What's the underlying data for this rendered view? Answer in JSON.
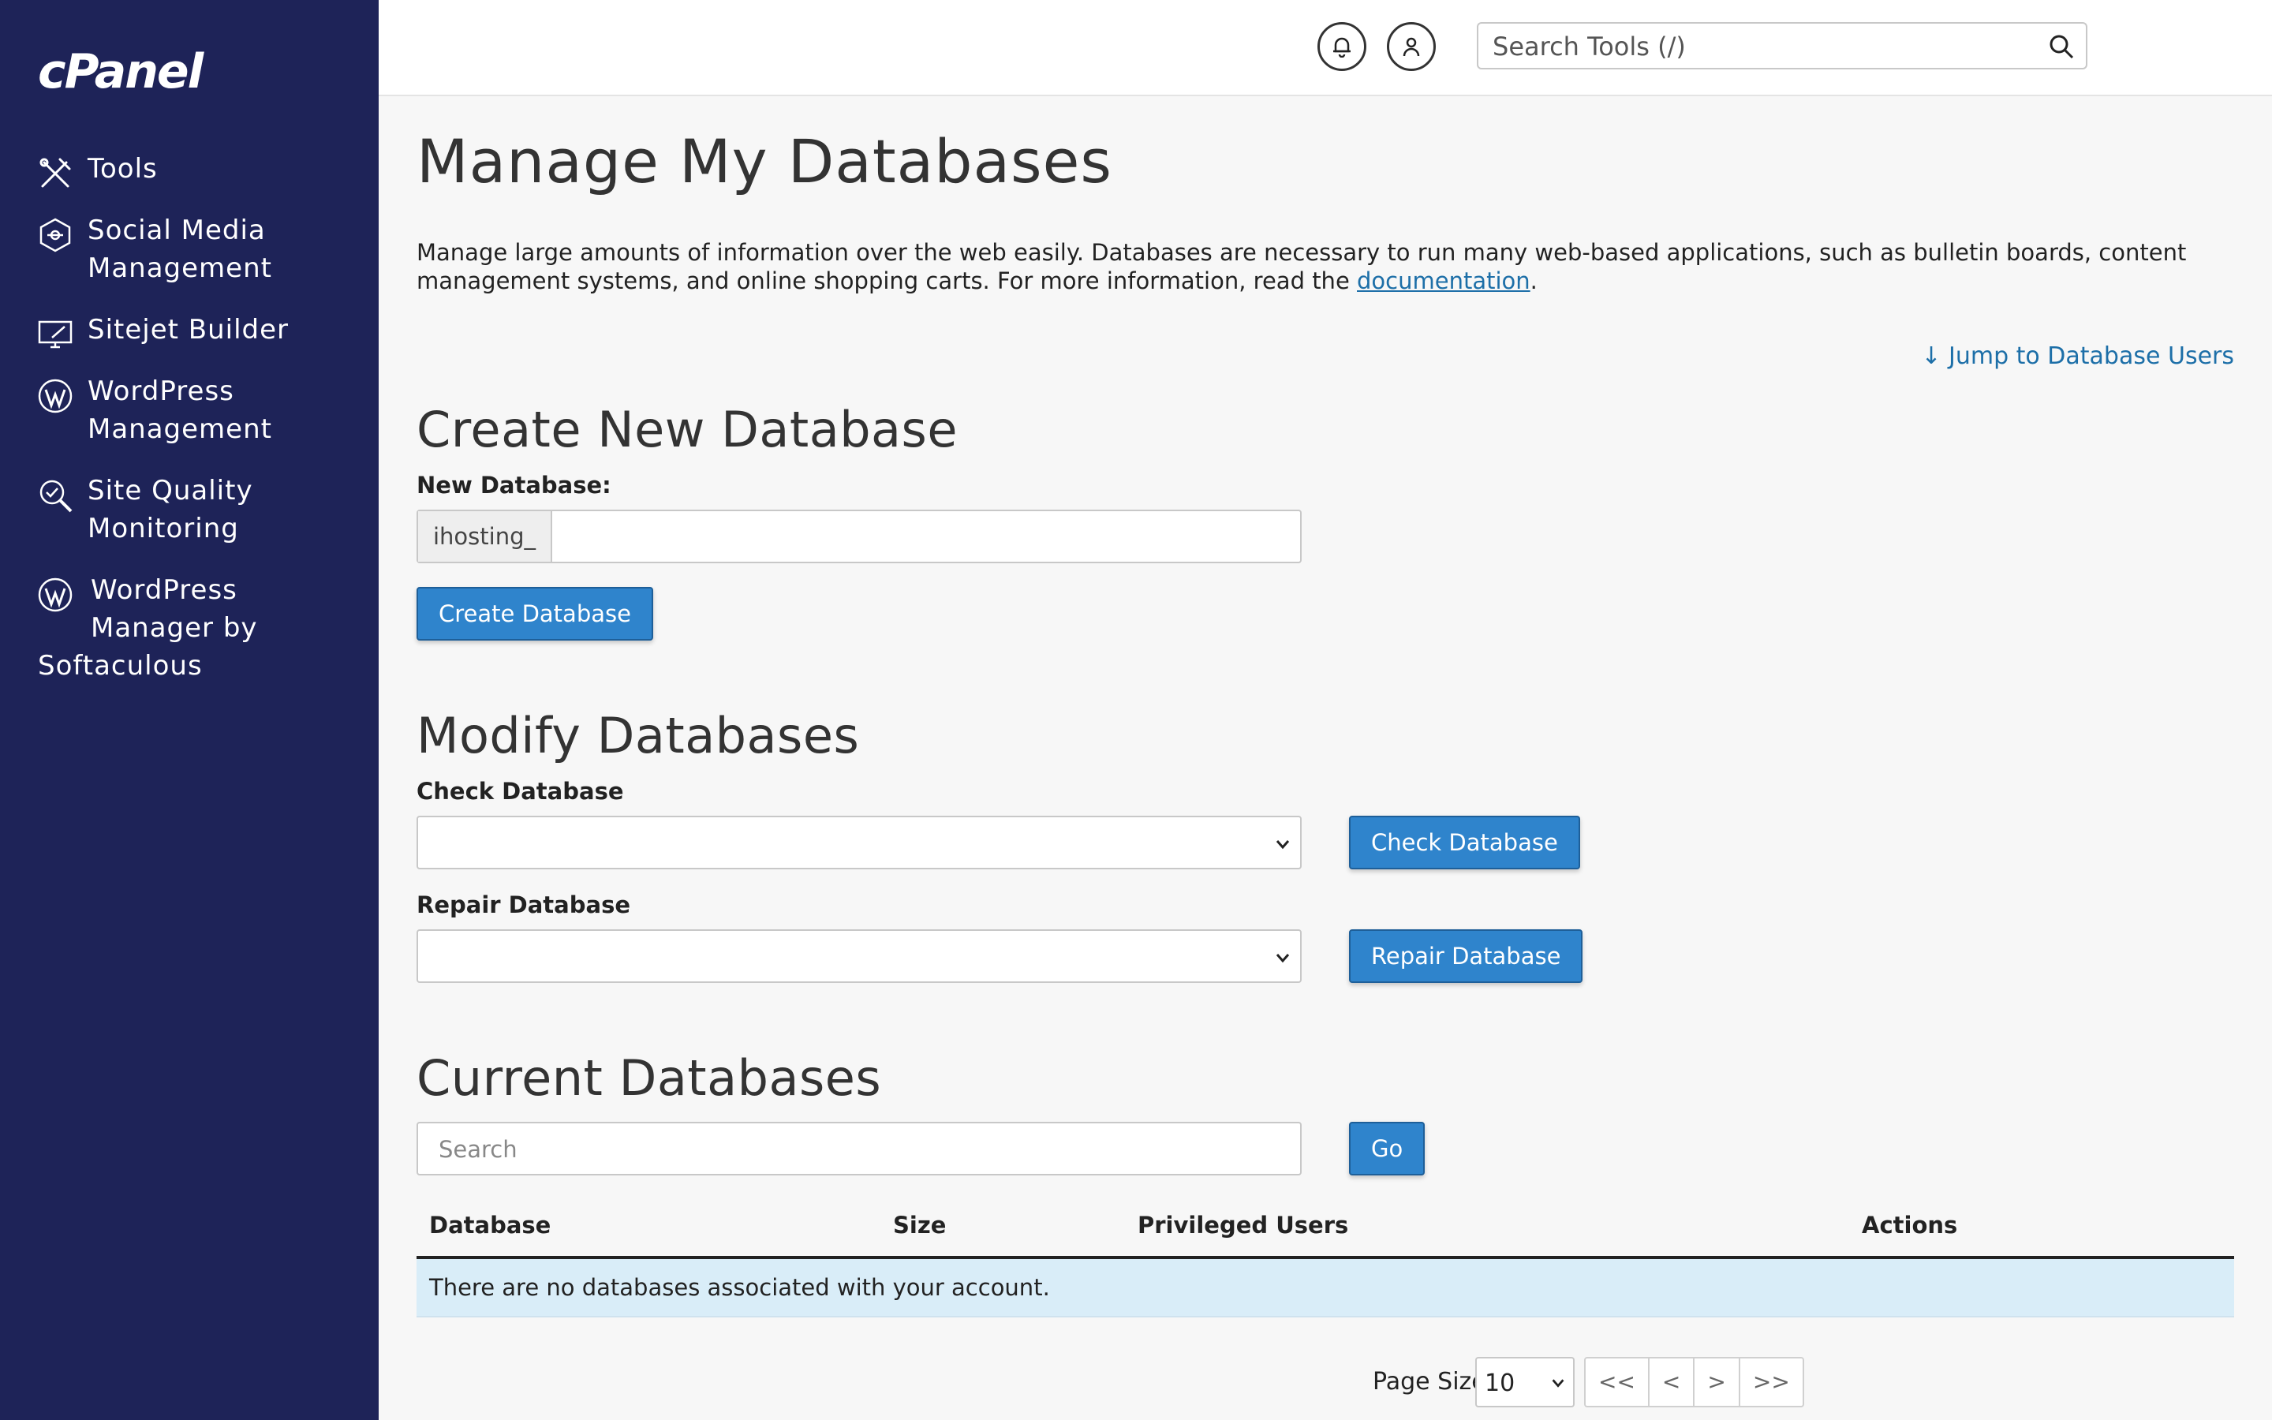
{
  "sidebar": {
    "logo": "cPanel",
    "items": [
      {
        "label": "Tools",
        "icon": "tools-icon"
      },
      {
        "label": "Social Media",
        "label2": "Management",
        "icon": "social-media-icon"
      },
      {
        "label": "Sitejet Builder",
        "icon": "sitejet-icon"
      },
      {
        "label": "WordPress",
        "label2": "Management",
        "icon": "wordpress-icon"
      },
      {
        "label": "Site Quality",
        "label2": "Monitoring",
        "icon": "site-quality-icon"
      },
      {
        "label": "WordPress",
        "label2": "Manager by",
        "label3": "Softaculous",
        "icon": "wordpress-icon"
      }
    ]
  },
  "header": {
    "search_placeholder": "Search Tools (/)"
  },
  "page": {
    "title": "Manage My Databases",
    "intro_text": "Manage large amounts of information over the web easily. Databases are necessary to run many web-based applications, such as bulletin boards, content management systems, and online shopping carts. For more information, read the ",
    "intro_link": "documentation",
    "intro_end": ".",
    "jump_link": "↓ Jump to Database Users"
  },
  "create": {
    "title": "Create New Database",
    "label": "New Database:",
    "prefix": "ihosting_",
    "value": "",
    "button": "Create Database"
  },
  "modify": {
    "title": "Modify Databases",
    "check_label": "Check Database",
    "check_button": "Check Database",
    "repair_label": "Repair Database",
    "repair_button": "Repair Database"
  },
  "current": {
    "title": "Current Databases",
    "search_placeholder": "Search",
    "go_button": "Go",
    "columns": [
      "Database",
      "Size",
      "Privileged Users",
      "Actions"
    ],
    "empty_message": "There are no databases associated with your account."
  },
  "pagination": {
    "page_size_label": "Page Size",
    "page_size": "10",
    "first": "<<",
    "prev": "<",
    "next": ">",
    "last": ">>"
  },
  "colors": {
    "sidebar_bg": "#1e2358",
    "primary_button": "#2f84cc",
    "link": "#1d6fa8",
    "empty_row": "#d9edf8"
  }
}
